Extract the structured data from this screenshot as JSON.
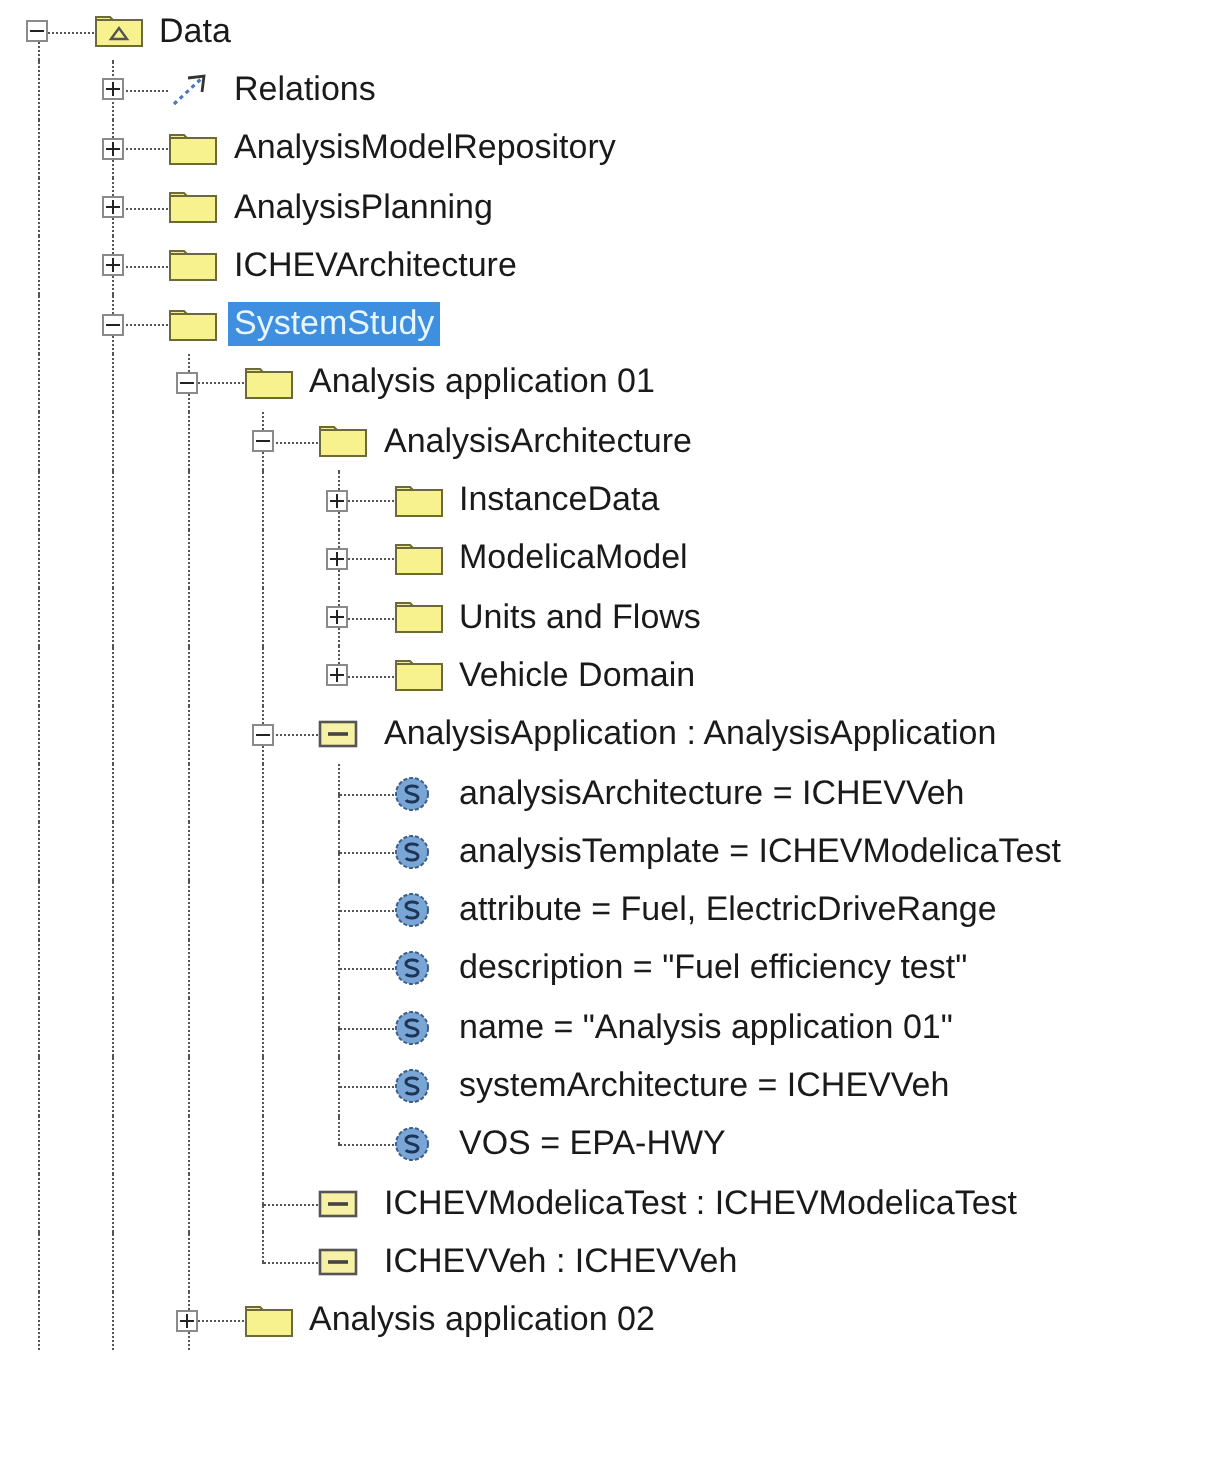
{
  "tree": [
    {
      "kind": "model",
      "label": "Data",
      "selected": false,
      "expanded": true,
      "children": [
        {
          "kind": "relations",
          "label": "Relations",
          "selected": false,
          "expanded": false
        },
        {
          "kind": "package",
          "label": "AnalysisModelRepository",
          "selected": false,
          "expanded": false
        },
        {
          "kind": "package",
          "label": "AnalysisPlanning",
          "selected": false,
          "expanded": false
        },
        {
          "kind": "package",
          "label": "ICHEVArchitecture",
          "selected": false,
          "expanded": false
        },
        {
          "kind": "package",
          "label": "SystemStudy",
          "selected": true,
          "expanded": true,
          "children": [
            {
              "kind": "package",
              "label": "Analysis application 01",
              "selected": false,
              "expanded": true,
              "children": [
                {
                  "kind": "package",
                  "label": "AnalysisArchitecture",
                  "selected": false,
                  "expanded": true,
                  "children": [
                    {
                      "kind": "package",
                      "label": "InstanceData",
                      "selected": false,
                      "expanded": false
                    },
                    {
                      "kind": "package",
                      "label": "ModelicaModel",
                      "selected": false,
                      "expanded": false
                    },
                    {
                      "kind": "package",
                      "label": "Units and Flows",
                      "selected": false,
                      "expanded": false
                    },
                    {
                      "kind": "package",
                      "label": "Vehicle Domain",
                      "selected": false,
                      "expanded": false
                    }
                  ]
                },
                {
                  "kind": "instance",
                  "label": "AnalysisApplication : AnalysisApplication",
                  "selected": false,
                  "expanded": true,
                  "children": [
                    {
                      "kind": "slot",
                      "label": "analysisArchitecture = ICHEVVeh",
                      "selected": false
                    },
                    {
                      "kind": "slot",
                      "label": "analysisTemplate = ICHEVModelicaTest",
                      "selected": false
                    },
                    {
                      "kind": "slot",
                      "label": "attribute = Fuel, ElectricDriveRange",
                      "selected": false
                    },
                    {
                      "kind": "slot",
                      "label": "description = \"Fuel efficiency test\"",
                      "selected": false
                    },
                    {
                      "kind": "slot",
                      "label": "name = \"Analysis application 01\"",
                      "selected": false
                    },
                    {
                      "kind": "slot",
                      "label": "systemArchitecture = ICHEVVeh",
                      "selected": false
                    },
                    {
                      "kind": "slot",
                      "label": "VOS = EPA-HWY",
                      "selected": false
                    }
                  ]
                },
                {
                  "kind": "instance",
                  "label": "ICHEVModelicaTest : ICHEVModelicaTest",
                  "selected": false
                },
                {
                  "kind": "instance",
                  "label": "ICHEVVeh : ICHEVVeh",
                  "selected": false
                }
              ]
            },
            {
              "kind": "package",
              "label": "Analysis application 02",
              "selected": false,
              "expanded": false
            }
          ]
        }
      ]
    }
  ]
}
